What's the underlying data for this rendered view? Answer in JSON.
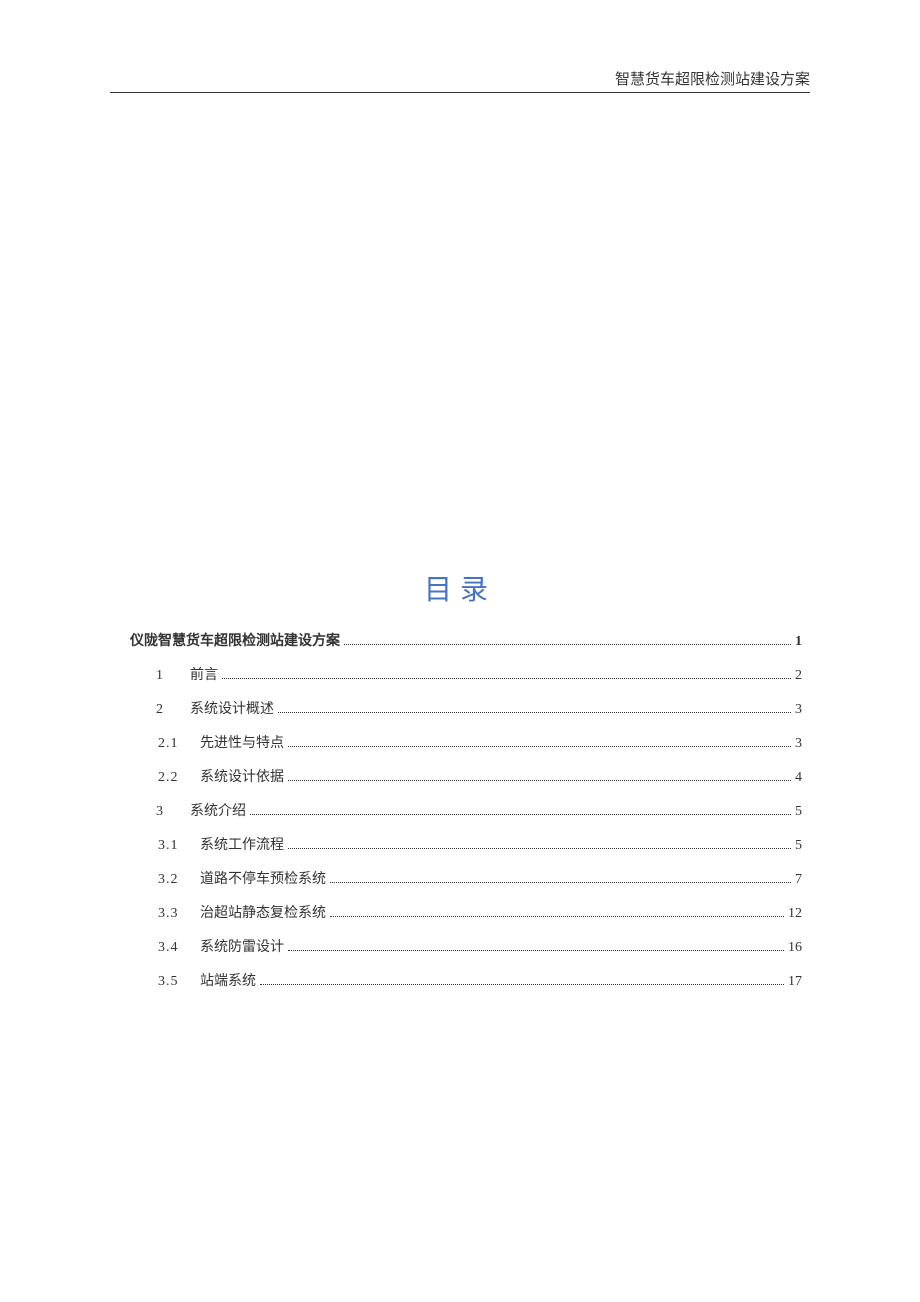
{
  "header": {
    "text": "智慧货车超限检测站建设方案"
  },
  "toc": {
    "title": "目录",
    "entries": [
      {
        "level": 0,
        "number": "",
        "text": "仪陇智慧货车超限检测站建设方案",
        "page": "1"
      },
      {
        "level": 1,
        "number": "1",
        "text": "前言",
        "page": "2"
      },
      {
        "level": 1,
        "number": "2",
        "text": "系统设计概述",
        "page": "3"
      },
      {
        "level": 2,
        "number": "2.1",
        "text": "先进性与特点",
        "page": "3"
      },
      {
        "level": 2,
        "number": "2.2",
        "text": "系统设计依据",
        "page": "4"
      },
      {
        "level": 1,
        "number": "3",
        "text": "系统介绍",
        "page": "5"
      },
      {
        "level": 2,
        "number": "3.1",
        "text": "系统工作流程",
        "page": "5"
      },
      {
        "level": 2,
        "number": "3.2",
        "text": "道路不停车预检系统",
        "page": "7"
      },
      {
        "level": 2,
        "number": "3.3",
        "text": "治超站静态复检系统",
        "page": "12"
      },
      {
        "level": 2,
        "number": "3.4",
        "text": "系统防雷设计",
        "page": "16"
      },
      {
        "level": 2,
        "number": "3.5",
        "text": "站端系统",
        "page": "17"
      }
    ]
  }
}
